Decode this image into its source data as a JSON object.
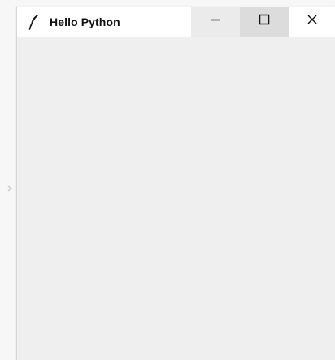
{
  "window": {
    "title": "Hello Python",
    "icon": "feather-icon",
    "controls": {
      "minimize_icon": "minimize-icon",
      "maximize_icon": "maximize-icon",
      "close_icon": "close-icon"
    }
  },
  "colors": {
    "titlebar_bg": "#ffffff",
    "client_bg": "#efefef",
    "minimize_bg": "#ebebeb",
    "maximize_bg": "#dcdcdc",
    "text": "#111111"
  }
}
